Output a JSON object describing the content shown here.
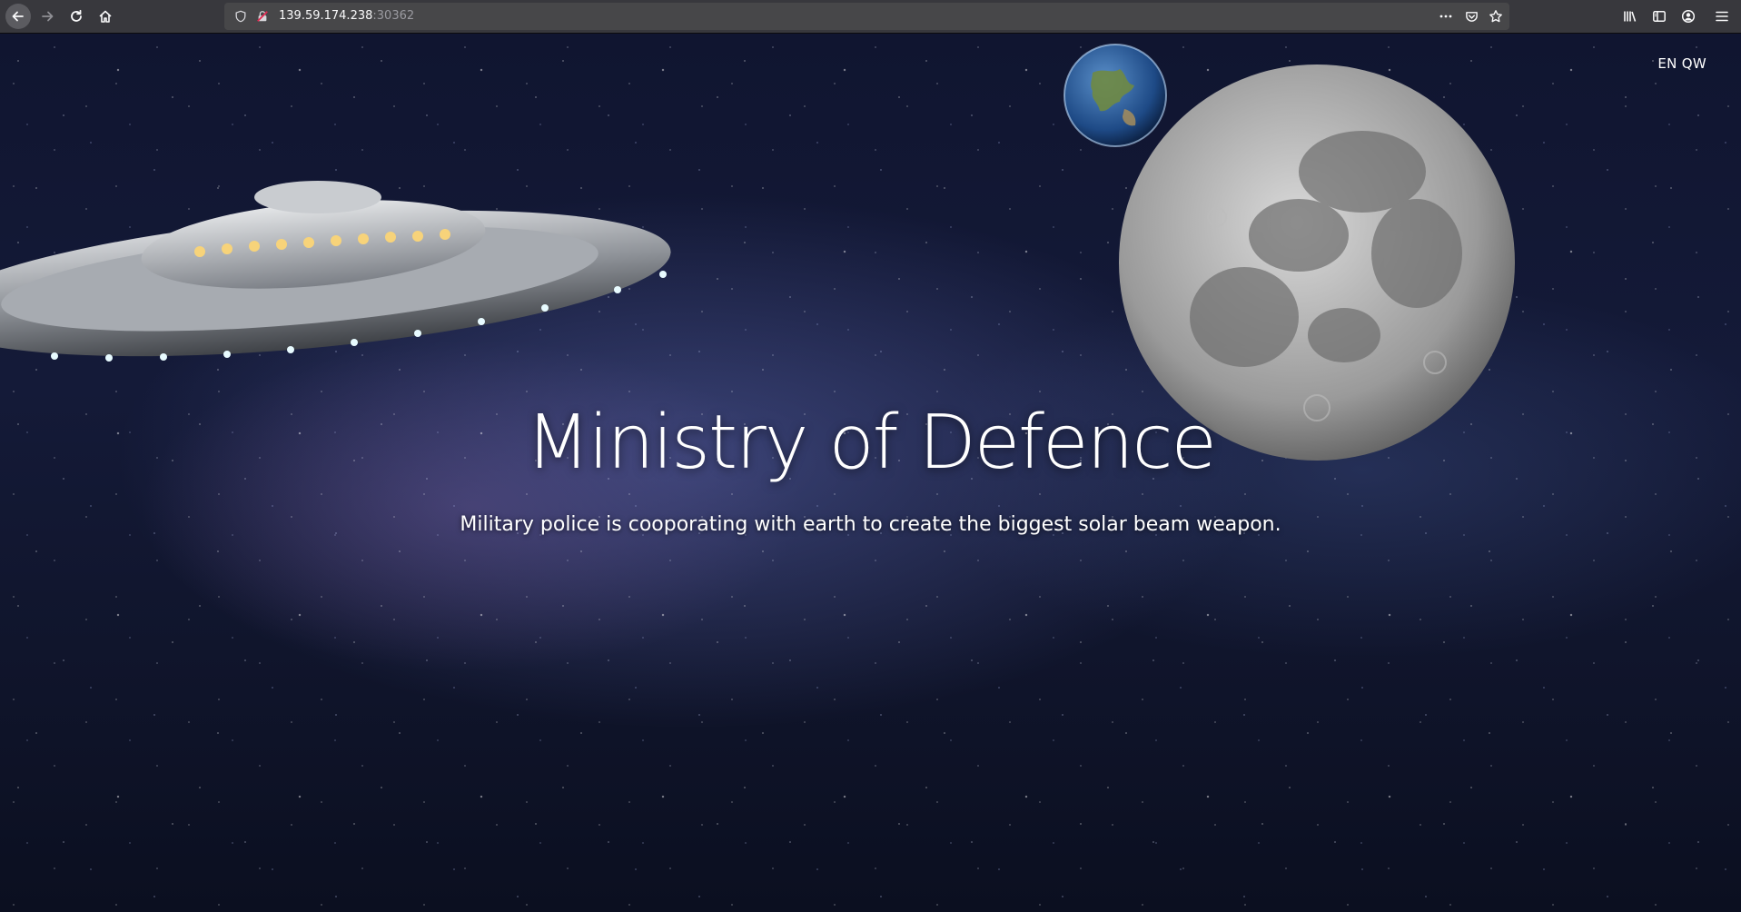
{
  "browser": {
    "url_host": "139.59.174.238",
    "url_port": ":30362"
  },
  "page": {
    "language_switch": "EN QW",
    "title": "Ministry of Defence",
    "subtitle": "Military police is cooporating with earth to create the biggest solar beam weapon."
  },
  "icons": {
    "back": "back-arrow-icon",
    "forward": "forward-arrow-icon",
    "reload": "reload-icon",
    "home": "home-icon",
    "shield": "tracking-shield-icon",
    "insecure": "insecure-lock-icon",
    "more": "more-actions-icon",
    "pocket": "pocket-icon",
    "bookmark": "bookmark-star-icon",
    "library": "library-icon",
    "sidebar": "sidebar-icon",
    "account": "account-icon",
    "menu": "hamburger-menu-icon"
  },
  "colors": {
    "toolbar": "#38383d",
    "urlbar": "#474749",
    "text": "#ffffff"
  }
}
